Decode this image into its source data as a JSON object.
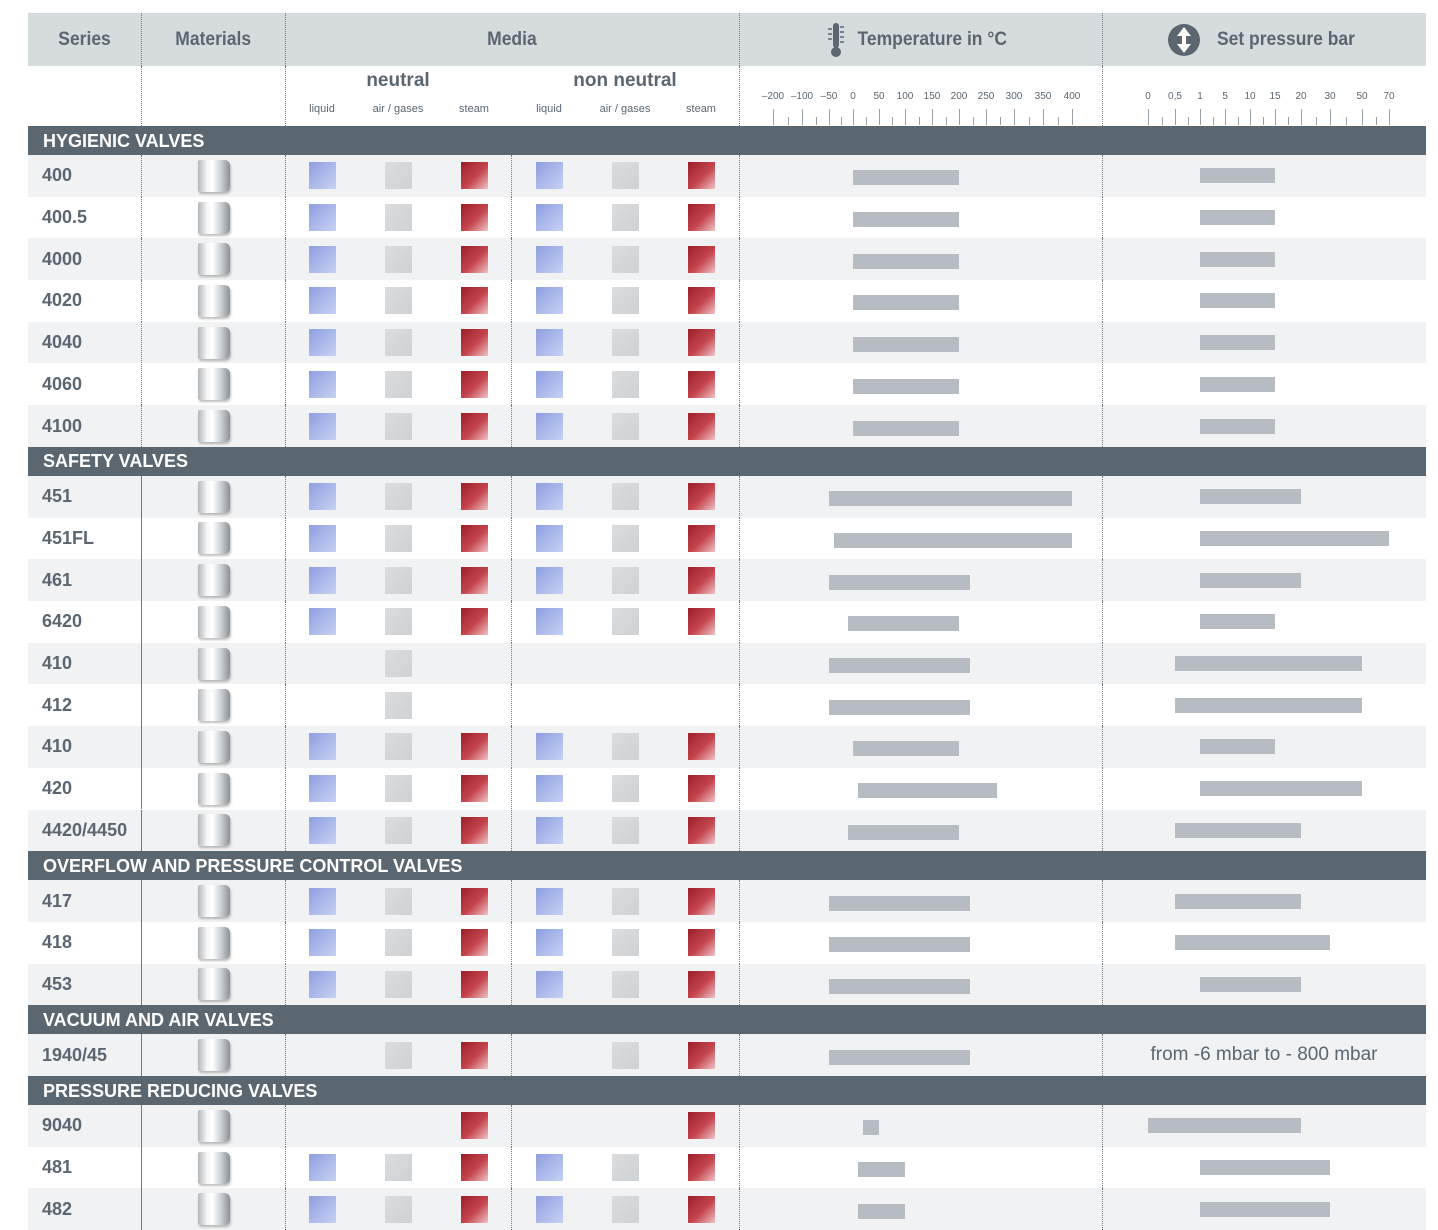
{
  "header": {
    "series": "Series",
    "materials": "Materials",
    "media": "Media",
    "temperature": "Temperature in °C",
    "pressure": "Set pressure bar",
    "neutral": "neutral",
    "non_neutral": "non neutral",
    "media_sub": [
      "liquid",
      "air / gases",
      "steam",
      "liquid",
      "air / gases",
      "steam"
    ],
    "temp_ticks": [
      "–200",
      "–100",
      "–50",
      "0",
      "50",
      "100",
      "150",
      "200",
      "250",
      "300",
      "350",
      "400"
    ],
    "pressure_ticks": [
      "0",
      "0,5",
      "1",
      "5",
      "10",
      "15",
      "20",
      "30",
      "50",
      "70"
    ]
  },
  "colors": {
    "liquid": "#a9b8ee",
    "air": "#d6d9db",
    "steam": "#b8323c",
    "section": "#5b6770",
    "bar": "#b6bcc2"
  },
  "sections": [
    {
      "title": "HYGIENIC VALVES",
      "rows": [
        {
          "series": "400",
          "media": [
            1,
            1,
            1,
            1,
            1,
            1
          ],
          "temp": [
            "-0",
            "200"
          ],
          "pressure": [
            "1",
            "15"
          ]
        },
        {
          "series": "400.5",
          "media": [
            1,
            1,
            1,
            1,
            1,
            1
          ],
          "temp": [
            "-0",
            "200"
          ],
          "pressure": [
            "1",
            "15"
          ]
        },
        {
          "series": "4000",
          "media": [
            1,
            1,
            1,
            1,
            1,
            1
          ],
          "temp": [
            "-0",
            "200"
          ],
          "pressure": [
            "1",
            "15"
          ]
        },
        {
          "series": "4020",
          "media": [
            1,
            1,
            1,
            1,
            1,
            1
          ],
          "temp": [
            "-0",
            "200"
          ],
          "pressure": [
            "1",
            "15"
          ]
        },
        {
          "series": "4040",
          "media": [
            1,
            1,
            1,
            1,
            1,
            1
          ],
          "temp": [
            "-0",
            "200"
          ],
          "pressure": [
            "1",
            "15"
          ]
        },
        {
          "series": "4060",
          "media": [
            1,
            1,
            1,
            1,
            1,
            1
          ],
          "temp": [
            "-0",
            "200"
          ],
          "pressure": [
            "1",
            "15"
          ]
        },
        {
          "series": "4100",
          "media": [
            1,
            1,
            1,
            1,
            1,
            1
          ],
          "temp": [
            "-0",
            "200"
          ],
          "pressure": [
            "1",
            "15"
          ]
        }
      ]
    },
    {
      "title": "SAFETY VALVES",
      "rows": [
        {
          "series": "451",
          "media": [
            1,
            1,
            1,
            1,
            1,
            1
          ],
          "temp": [
            "-50",
            "400"
          ],
          "pressure": [
            "1",
            "20"
          ]
        },
        {
          "series": "451FL",
          "media": [
            1,
            1,
            1,
            1,
            1,
            1
          ],
          "temp": [
            "-40",
            "400"
          ],
          "pressure": [
            "1",
            "70"
          ]
        },
        {
          "series": "461",
          "media": [
            1,
            1,
            1,
            1,
            1,
            1
          ],
          "temp": [
            "-50",
            "220"
          ],
          "pressure": [
            "1",
            "20"
          ]
        },
        {
          "series": "6420",
          "media": [
            1,
            1,
            1,
            1,
            1,
            1
          ],
          "temp": [
            "-10",
            "200"
          ],
          "pressure": [
            "1",
            "15"
          ]
        },
        {
          "series": "410",
          "media": [
            0,
            1,
            0,
            0,
            0,
            0
          ],
          "temp": [
            "-50",
            "220"
          ],
          "pressure": [
            "0,5",
            "50"
          ]
        },
        {
          "series": "412",
          "media": [
            0,
            1,
            0,
            0,
            0,
            0
          ],
          "temp": [
            "-50",
            "220"
          ],
          "pressure": [
            "0,5",
            "50"
          ]
        },
        {
          "series": "410",
          "media": [
            1,
            1,
            1,
            1,
            1,
            1
          ],
          "temp": [
            "-0",
            "200"
          ],
          "pressure": [
            "1",
            "15"
          ]
        },
        {
          "series": "420",
          "media": [
            1,
            1,
            1,
            1,
            1,
            1
          ],
          "temp": [
            "10",
            "270"
          ],
          "pressure": [
            "1",
            "50"
          ]
        },
        {
          "series": "4420/4450",
          "media": [
            1,
            1,
            1,
            1,
            1,
            1
          ],
          "temp": [
            "-10",
            "200"
          ],
          "pressure": [
            "0,5",
            "20"
          ]
        }
      ]
    },
    {
      "title": "OVERFLOW AND PRESSURE CONTROL VALVES",
      "rows": [
        {
          "series": "417",
          "media": [
            1,
            1,
            1,
            1,
            1,
            1
          ],
          "temp": [
            "-50",
            "220"
          ],
          "pressure": [
            "0,5",
            "20"
          ]
        },
        {
          "series": "418",
          "media": [
            1,
            1,
            1,
            1,
            1,
            1
          ],
          "temp": [
            "-50",
            "220"
          ],
          "pressure": [
            "0,5",
            "30"
          ]
        },
        {
          "series": "453",
          "media": [
            1,
            1,
            1,
            1,
            1,
            1
          ],
          "temp": [
            "-50",
            "220"
          ],
          "pressure": [
            "1",
            "20"
          ]
        }
      ]
    },
    {
      "title": "VACUUM AND AIR VALVES",
      "rows": [
        {
          "series": "1940/45",
          "media": [
            0,
            1,
            1,
            0,
            1,
            1
          ],
          "temp": [
            "-50",
            "220"
          ],
          "pressure_note": "from -6 mbar to - 800 mbar"
        }
      ]
    },
    {
      "title": "PRESSURE REDUCING VALVES",
      "rows": [
        {
          "series": "9040",
          "media": [
            0,
            0,
            1,
            0,
            0,
            1
          ],
          "temp": [
            "20",
            "50"
          ],
          "pressure": [
            "0",
            "20"
          ]
        },
        {
          "series": "481",
          "media": [
            1,
            1,
            1,
            1,
            1,
            1
          ],
          "temp": [
            "10",
            "100"
          ],
          "pressure": [
            "1",
            "30"
          ]
        },
        {
          "series": "482",
          "media": [
            1,
            1,
            1,
            1,
            1,
            1
          ],
          "temp": [
            "10",
            "100"
          ],
          "pressure": [
            "1",
            "30"
          ]
        }
      ]
    }
  ]
}
